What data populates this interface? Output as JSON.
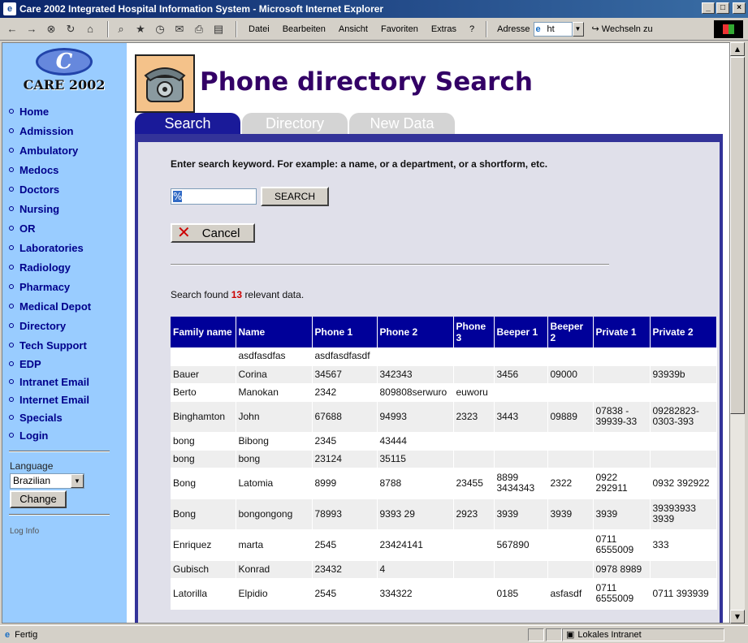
{
  "window": {
    "title": "Care 2002 Integrated Hospital Information System - Microsoft Internet Explorer"
  },
  "toolbar": {
    "menu": [
      "Datei",
      "Bearbeiten",
      "Ansicht",
      "Favoriten",
      "Extras",
      "?"
    ],
    "address_label": "Adresse",
    "address_value": "ht",
    "go_label": "Wechseln zu"
  },
  "sidebar": {
    "logo_text": "CARE 2002",
    "nav": [
      "Home",
      "Admission",
      "Ambulatory",
      "Medocs",
      "Doctors",
      "Nursing",
      "OR",
      "Laboratories",
      "Radiology",
      "Pharmacy",
      "Medical Depot",
      "Directory",
      "Tech Support",
      "EDP",
      "Intranet Email",
      "Internet Email",
      "Specials",
      "Login"
    ],
    "language_label": "Language",
    "language_value": "Brazilian",
    "change_label": "Change",
    "loginfo_label": "Log Info"
  },
  "main": {
    "title": "Phone directory Search",
    "tabs": [
      "Search",
      "Directory",
      "New Data"
    ],
    "instruction": "Enter search keyword. For example: a name, or a department, or a shortform, etc.",
    "search_value": "%",
    "search_button": "SEARCH",
    "cancel_button": "Cancel",
    "found_prefix": "Search found",
    "found_count": "13",
    "found_suffix": "relevant data."
  },
  "table": {
    "headers": [
      "Family name",
      "Name",
      "Phone 1",
      "Phone 2",
      "Phone 3",
      "Beeper 1",
      "Beeper 2",
      "Private 1",
      "Private 2"
    ],
    "rows": [
      [
        "",
        "asdfasdfas",
        "asdfasdfasdf",
        "",
        "",
        "",
        "",
        "",
        ""
      ],
      [
        "Bauer",
        "Corina",
        "34567",
        "342343",
        "",
        "3456",
        "09000",
        "",
        "93939b"
      ],
      [
        "Berto",
        "Manokan",
        "2342",
        "809808serwuro",
        "euworu",
        "",
        "",
        "",
        ""
      ],
      [
        "Binghamton",
        "John",
        "67688",
        "94993",
        "2323",
        "3443",
        "09889",
        "07838 - 39939-33",
        "09282823-0303-393"
      ],
      [
        "bong",
        "Bibong",
        "2345",
        "43444",
        "",
        "",
        "",
        "",
        ""
      ],
      [
        "bong",
        "bong",
        "23124",
        "35115",
        "",
        "",
        "",
        "",
        ""
      ],
      [
        "Bong",
        "Latomia",
        "8999",
        "8788",
        "23455",
        "8899 3434343",
        "2322",
        "0922 292911",
        "0932 392922"
      ],
      [
        "Bong",
        "bongongong",
        "78993",
        "9393 29",
        "2923",
        "3939",
        "3939",
        "3939",
        "39393933 3939"
      ],
      [
        "Enriquez",
        "marta",
        "2545",
        "23424141",
        "",
        "567890",
        "",
        "0711 6555009",
        "333"
      ],
      [
        "Gubisch",
        "Konrad",
        "23432",
        "4",
        "",
        "",
        "",
        "0978 8989",
        ""
      ],
      [
        "Latorilla",
        "Elpidio",
        "2545",
        "334322",
        "",
        "0185",
        "asfasdf",
        "0711 6555009",
        "0711 393939"
      ]
    ]
  },
  "status": {
    "left": "Fertig",
    "zone": "Lokales Intranet"
  }
}
